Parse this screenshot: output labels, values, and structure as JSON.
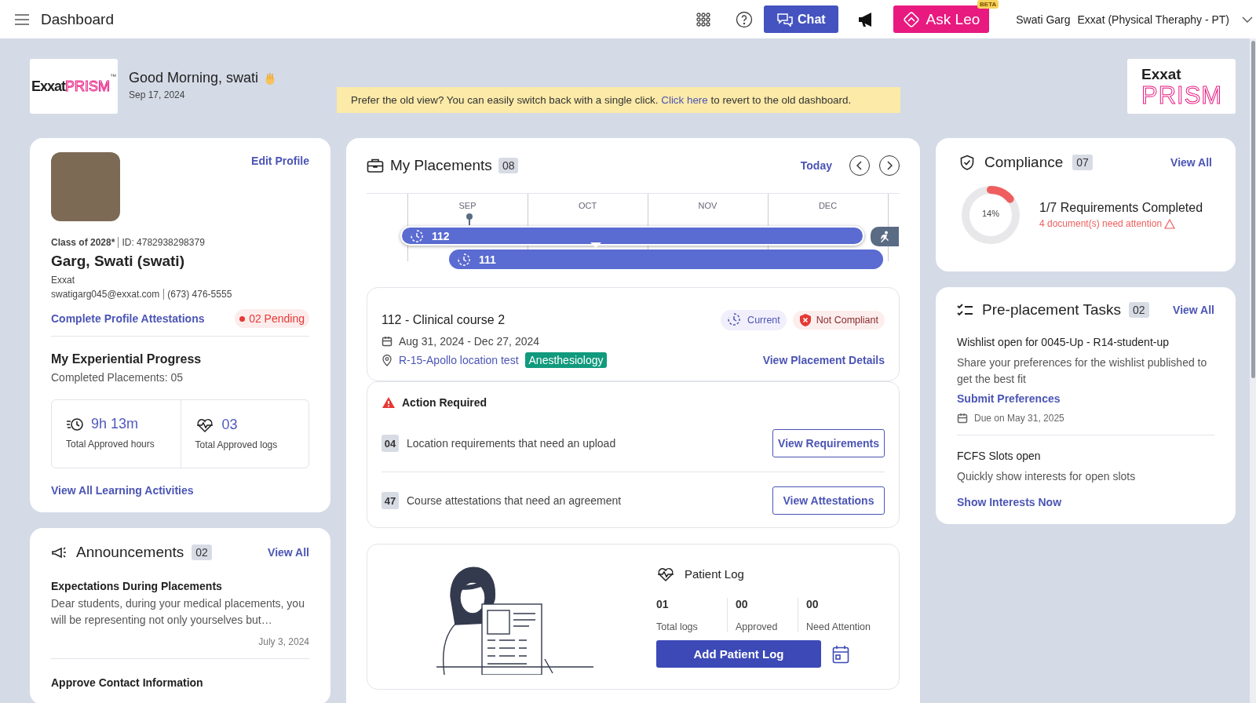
{
  "top_bar": {
    "title": "Dashboard",
    "chat_button": "Chat",
    "ask_button": "Ask Leo",
    "ask_badge": "BETA",
    "user_name": "Swati Garg",
    "program": "Exxat (Physical Theraphy - PT)"
  },
  "header": {
    "logo_left": {
      "word1": "Exxat",
      "word2": "PRISM",
      "mark": "™"
    },
    "greeting": "Good Morning, swati",
    "date": "Sep 17, 2024",
    "banner": {
      "before": "Prefer the old view? You can easily switch back with a single click.",
      "link": "Click here",
      "after": "to revert to the old dashboard."
    },
    "logo_right": {
      "word1": "Exxat",
      "word2": "PRISM"
    }
  },
  "profile": {
    "edit_link": "Edit Profile",
    "class_of": "Class of 2028*",
    "id": "ID: 4782938298379",
    "name": "Garg, Swati (swati)",
    "organization": "Exxat",
    "email": "swatigarg045@exxat.com",
    "phone": "(673) 476-5555",
    "attestations_link": "Complete Profile Attestations",
    "pending": "02 Pending",
    "progress_title": "My Experiential Progress",
    "completed": "Completed Placements: 05",
    "stats": [
      {
        "kind": "hours",
        "value": "9h 13m",
        "label": "Total Approved hours"
      },
      {
        "kind": "logs",
        "value": "03",
        "label": "Total Approved logs"
      }
    ],
    "activities_link": "View All Learning Activities"
  },
  "announcements": {
    "title": "Announcements",
    "count": "02",
    "view_all": "View All",
    "items": [
      {
        "title": "Expectations During Placements",
        "body": "Dear students, during your medical placements, you will be representing not only yourselves but…",
        "date": "July 3, 2024"
      },
      {
        "title": "Approve Contact Information"
      }
    ]
  },
  "placements": {
    "title": "My Placements",
    "count": "08",
    "today": "Today",
    "months": [
      "SEP",
      "OCT",
      "NOV",
      "DEC"
    ],
    "bars": [
      {
        "label": "112",
        "selected": true
      },
      {
        "label": "111",
        "selected": false
      }
    ],
    "detail": {
      "title": "112 - Clinical course 2",
      "badges": [
        {
          "kind": "current",
          "label": "Current"
        },
        {
          "kind": "noncompliant",
          "label": "Not Compliant"
        }
      ],
      "dates": "Aug 31, 2024 - Dec 27, 2024",
      "location": "R-15-Apollo location test",
      "specialty": "Anesthesiology",
      "details_link": "View Placement Details"
    },
    "action": {
      "title": "Action Required",
      "items": [
        {
          "count": "04",
          "text": "Location requirements that need an upload",
          "button": "View Requirements"
        },
        {
          "count": "47",
          "text": "Course attestations that need an agreement",
          "button": "View Attestations"
        }
      ]
    },
    "patient_log": {
      "title": "Patient Log",
      "stats": [
        {
          "value": "01",
          "label": "Total logs"
        },
        {
          "value": "00",
          "label": "Approved"
        },
        {
          "value": "00",
          "label": "Need Attention"
        }
      ],
      "button": "Add Patient Log"
    }
  },
  "compliance": {
    "title": "Compliance",
    "count": "07",
    "view_all": "View All",
    "percent": "14%",
    "level": 0.14,
    "summary": "1/7 Requirements Completed",
    "warning": "4 document(s) need attention"
  },
  "tasks": {
    "title": "Pre-placement Tasks",
    "count": "02",
    "view_all": "View All",
    "items": [
      {
        "title": "Wishlist open for 0045-Up - R14-student-up",
        "description": "Share your preferences for the wishlist published to get the best fit",
        "link": "Submit Preferences",
        "due": "Due on May 31, 2025"
      },
      {
        "title": "FCFS Slots open",
        "description": "Quickly show interests for open slots",
        "link": "Show Interests Now"
      }
    ]
  }
}
